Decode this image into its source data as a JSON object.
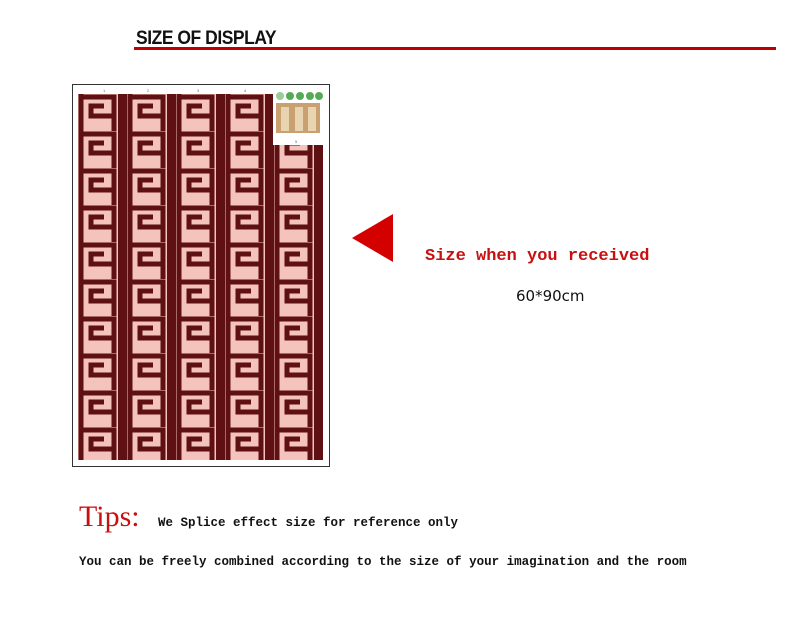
{
  "header": {
    "title": "SIZE OF DISPLAY"
  },
  "product": {
    "received_label": "Size when you received",
    "size": "60*90cm",
    "strip_numbers": [
      "1",
      "2",
      "3",
      "4",
      "5"
    ]
  },
  "tips": {
    "label": "Tips:",
    "line1": "We Splice effect size for reference only",
    "line2": "You can be freely combined according to the size of your imagination and the room"
  },
  "colors": {
    "accent": "#c81010",
    "pattern_dark": "#5e1012",
    "pattern_light": "#f4c4bc"
  }
}
